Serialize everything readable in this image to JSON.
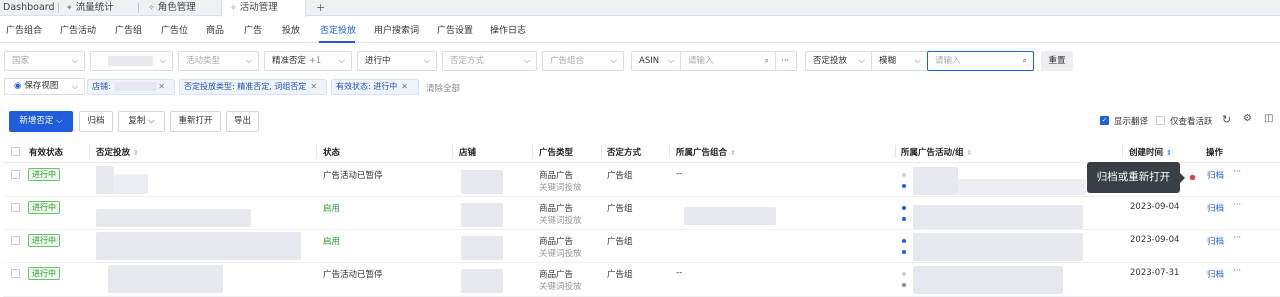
{
  "browser_tabs": [
    {
      "label": "Dashboard",
      "pinned": false,
      "active": false
    },
    {
      "label": "流量统计",
      "pinned": true,
      "active": false
    },
    {
      "label": "角色管理",
      "pinned": true,
      "active": false
    },
    {
      "label": "活动管理",
      "pinned": true,
      "active": true
    }
  ],
  "new_tab_glyph": "+",
  "nav_tabs": [
    "广告组合",
    "广告活动",
    "广告组",
    "广告位",
    "商品",
    "广告",
    "投放",
    "否定投放",
    "用户搜索词",
    "广告设置",
    "操作日志"
  ],
  "nav_active_index": 7,
  "filters": {
    "country_placeholder": "国家",
    "activity_type_placeholder": "活动类型",
    "neg_match_value": "精准否定",
    "neg_match_more": "+1",
    "status_value": "进行中",
    "neg_method_placeholder": "否定方式",
    "ad_group_combo_placeholder": "广告组合",
    "asin_label": "ASIN",
    "asin_input_placeholder": "请输入",
    "more_glyph": "···",
    "neg_target_label": "否定投放",
    "fuzzy_label": "模糊",
    "search_input_placeholder": "请输入",
    "reset_label": "重置"
  },
  "saved_view_label": "保存视图",
  "active_chips": [
    {
      "label": "店铺: "
    },
    {
      "label": "否定投放类型: 精准否定, 词组否定"
    },
    {
      "label": "有效状态: 进行中"
    }
  ],
  "clear_all_label": "清除全部",
  "toolbar": {
    "new_negative_label": "新增否定",
    "archive_label": "归档",
    "copy_label": "复制",
    "reopen_label": "重新打开",
    "export_label": "导出",
    "show_translation_label": "显示翻译",
    "only_active_label": "仅查看活跃"
  },
  "table": {
    "headers": [
      "有效状态",
      "否定投放",
      "状态",
      "店铺",
      "广告类型",
      "否定方式",
      "所属广告组合",
      "所属广告活动/组",
      "创建时间",
      "操作"
    ],
    "rows": [
      {
        "valid_status": "进行中",
        "status": "广告活动已暂停",
        "status_color": "normal",
        "ad_type": "商品广告",
        "ad_subtype": "关键词投放",
        "neg_method": "广告组",
        "combo": "--",
        "created": "",
        "action": "归档"
      },
      {
        "valid_status": "进行中",
        "status": "启用",
        "status_color": "green",
        "ad_type": "商品广告",
        "ad_subtype": "关键词投放",
        "neg_method": "广告组",
        "combo": "",
        "created": "2023-09-04",
        "action": "归档"
      },
      {
        "valid_status": "进行中",
        "status": "启用",
        "status_color": "green",
        "ad_type": "商品广告",
        "ad_subtype": "关键词投放",
        "neg_method": "广告组",
        "combo": "",
        "created": "2023-09-04",
        "action": "归档"
      },
      {
        "valid_status": "进行中",
        "status": "广告活动已暂停",
        "status_color": "normal",
        "ad_type": "商品广告",
        "ad_subtype": "关键词投放",
        "neg_method": "广告组",
        "combo": "--",
        "created": "2023-07-31",
        "action": "归档"
      }
    ],
    "more_glyph": "···"
  },
  "tooltip_text": "归档或重新打开",
  "colors": {
    "accent": "#1f5ddb",
    "active_green": "#2e9a2e",
    "tooltip_bg": "#3a3f47"
  }
}
